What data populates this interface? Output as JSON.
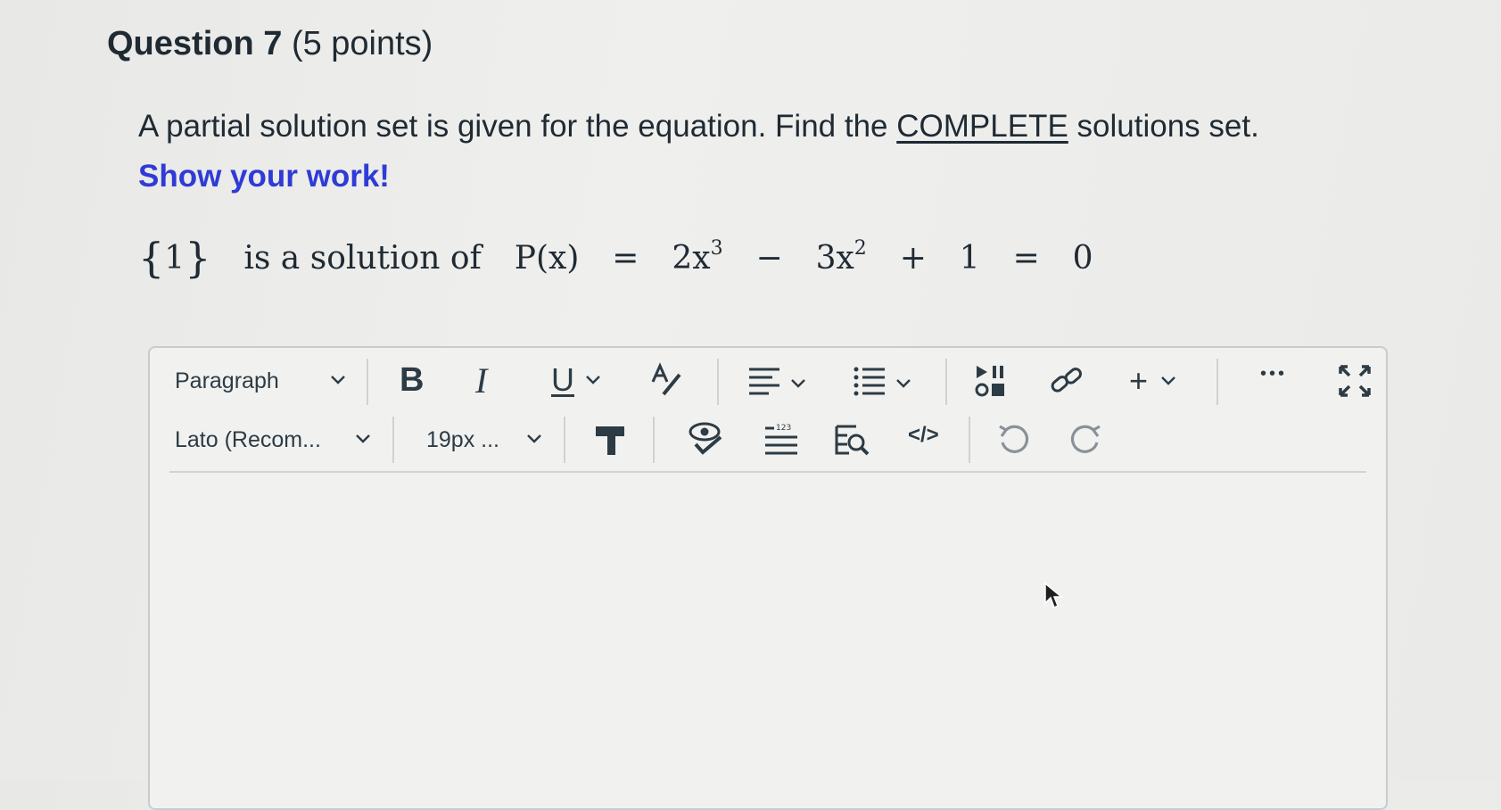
{
  "question": {
    "number_label": "Question 7",
    "points_label": "(5 points)"
  },
  "prompt": {
    "part1": "A partial solution set is given for the equation.  Find the ",
    "underlined": "COMPLETE",
    "part2": " solutions set.",
    "emphasis": "Show your work!"
  },
  "math": {
    "brace_open": "{",
    "set_value": "1",
    "brace_close": "}",
    "words": "is a solution of",
    "lhs": "P(x)",
    "eq1": "=",
    "term1_coef": "2x",
    "term1_exp": "3",
    "minus": "−",
    "term2_coef": "3x",
    "term2_exp": "2",
    "plus": "+",
    "const": "1",
    "eq2": "=",
    "rhs": "0"
  },
  "toolbar": {
    "block_format": "Paragraph",
    "font_family": "Lato (Recom...",
    "font_size": "19px ...",
    "bold": "B",
    "italic": "I",
    "underline": "U",
    "more": "•••",
    "html": "</>",
    "insert": "+"
  },
  "colors": {
    "accent_blue": "#2f3bd6",
    "text": "#1f2a33",
    "icon": "#2d3b45"
  }
}
